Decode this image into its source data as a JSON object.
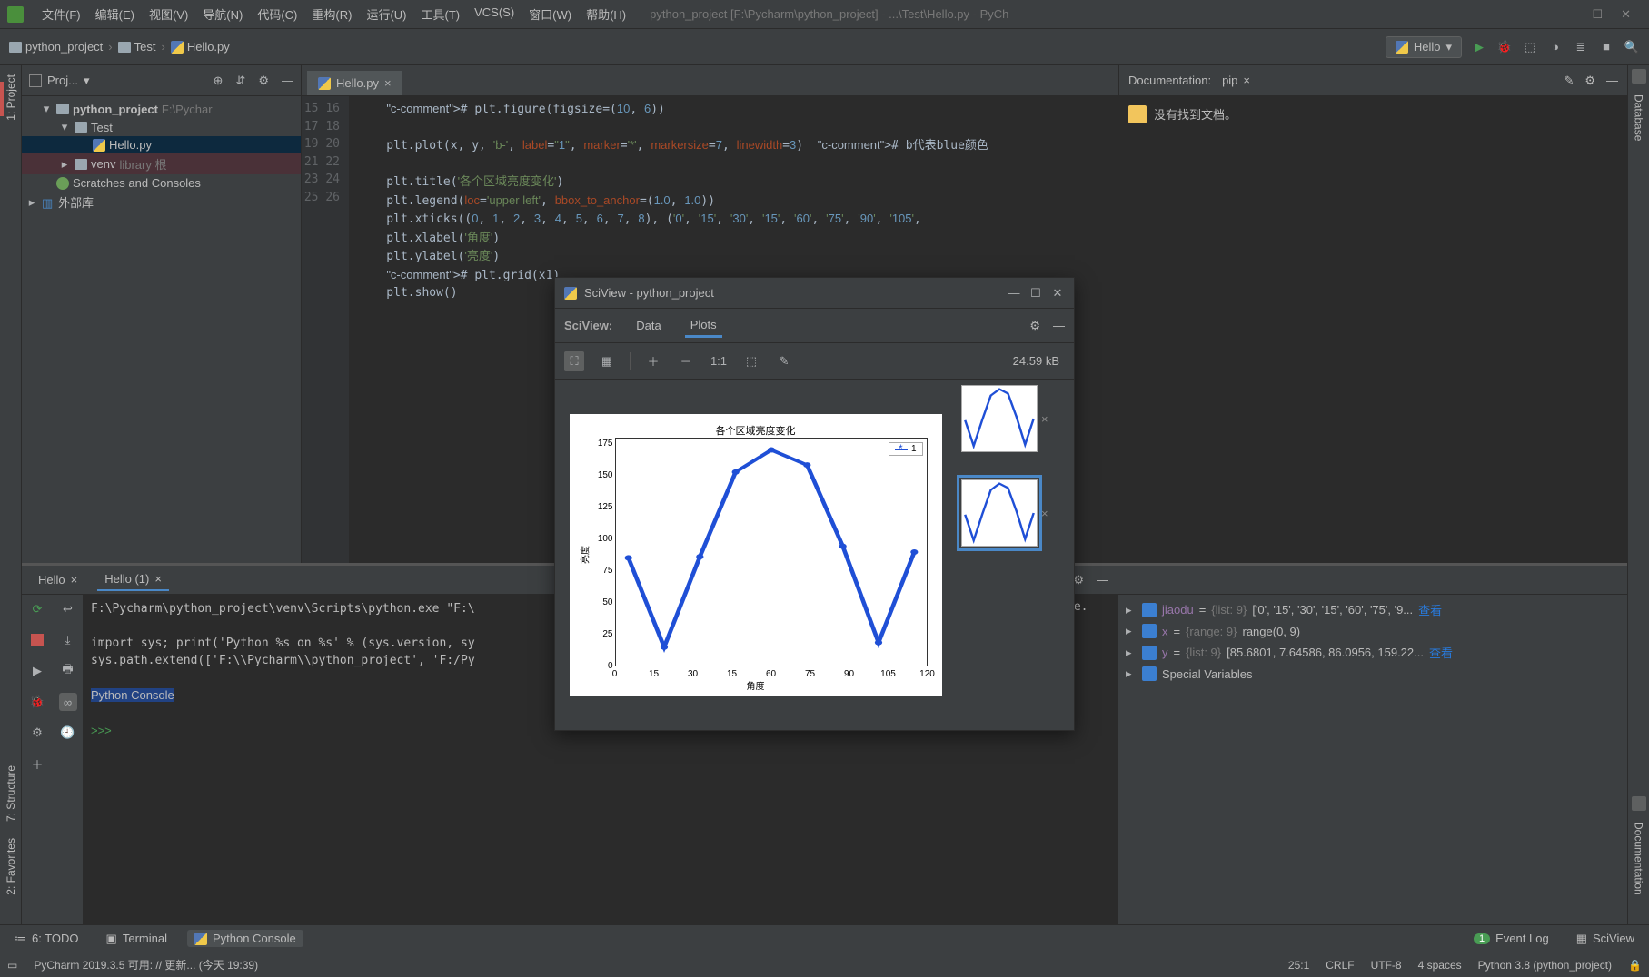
{
  "window": {
    "title": "python_project [F:\\Pycharm\\python_project] - ...\\Test\\Hello.py - PyCh"
  },
  "menu": [
    "文件(F)",
    "编辑(E)",
    "视图(V)",
    "导航(N)",
    "代码(C)",
    "重构(R)",
    "运行(U)",
    "工具(T)",
    "VCS(S)",
    "窗口(W)",
    "帮助(H)"
  ],
  "breadcrumb": {
    "root": "python_project",
    "dir": "Test",
    "file": "Hello.py"
  },
  "run_config": {
    "name": "Hello"
  },
  "left_tabs": {
    "project": "1: Project",
    "structure": "7: Structure",
    "favorites": "2: Favorites"
  },
  "right_tabs": {
    "database": "Database",
    "documentation": "Documentation"
  },
  "project_panel": {
    "title": "Proj...",
    "root": "python_project",
    "root_hint": "F:\\Pychar",
    "test_dir": "Test",
    "file": "Hello.py",
    "venv": "venv",
    "venv_hint": "library 根",
    "scratches": "Scratches and Consoles",
    "external": "外部库"
  },
  "editor": {
    "tab": "Hello.py",
    "first_line": "15",
    "lines": [
      "    # plt.figure(figsize=(10, 6))",
      "",
      "    plt.plot(x, y, 'b-', label=\"1\", marker='*', markersize=7, linewidth=3)  # b代表blue颜色",
      "",
      "    plt.title('各个区域亮度变化')",
      "    plt.legend(loc='upper left', bbox_to_anchor=(1.0, 1.0))",
      "    plt.xticks((0, 1, 2, 3, 4, 5, 6, 7, 8), ('0', '15', '30', '15', '60', '75', '90', '105',",
      "    plt.xlabel('角度')",
      "    plt.ylabel('亮度')",
      "    # plt.grid(x1)",
      "    plt.show()",
      ""
    ]
  },
  "docs": {
    "label": "Documentation:",
    "for": "pip",
    "empty": "没有找到文档。"
  },
  "console": {
    "tabs": {
      "hello": "Hello",
      "hello1": "Hello (1)"
    },
    "lines": [
      "F:\\Pycharm\\python_project\\venv\\Scripts\\python.exe \"F:\\",
      "",
      "import sys; print('Python %s on %s' % (sys.version, sy",
      "sys.path.extend(['F:\\\\Pycharm\\\\python_project', 'F:/Py",
      "",
      "Python Console",
      "",
      ">>>"
    ],
    "extra_right": "le."
  },
  "vars": [
    {
      "name": "jiaodu",
      "type": "{list: 9}",
      "val": "['0', '15', '30', '15', '60', '75', '9...",
      "link": "查看"
    },
    {
      "name": "x",
      "type": "{range: 9}",
      "val": "range(0, 9)"
    },
    {
      "name": "y",
      "type": "{list: 9}",
      "val": "[85.6801, 7.64586, 86.0956, 159.22...",
      "link": "查看"
    },
    {
      "name": "Special Variables"
    }
  ],
  "bottom_tabs": {
    "todo": "6: TODO",
    "terminal": "Terminal",
    "pyconsole": "Python Console",
    "eventlog": "Event Log",
    "sciview": "SciView"
  },
  "status": {
    "msg": "PyCharm 2019.3.5 可用: // 更新... (今天 19:39)",
    "pos": "25:1",
    "sep": "CRLF",
    "enc": "UTF-8",
    "indent": "4 spaces",
    "sdk": "Python 3.8 (python_project)"
  },
  "sciview": {
    "title": "SciView - python_project",
    "label": "SciView:",
    "tabs": {
      "data": "Data",
      "plots": "Plots"
    },
    "size": "24.59 kB"
  },
  "chart_data": {
    "type": "line",
    "title": "各个区域亮度变化",
    "xlabel": "角度",
    "ylabel": "亮度",
    "legend": "1",
    "x_categories": [
      "0",
      "15",
      "30",
      "15",
      "60",
      "75",
      "90",
      "105",
      "120"
    ],
    "y_ticks": [
      0,
      25,
      50,
      75,
      100,
      125,
      150,
      175
    ],
    "ylim": [
      0,
      180
    ],
    "values": [
      85,
      8,
      86,
      159,
      178,
      165,
      95,
      12,
      90
    ]
  }
}
